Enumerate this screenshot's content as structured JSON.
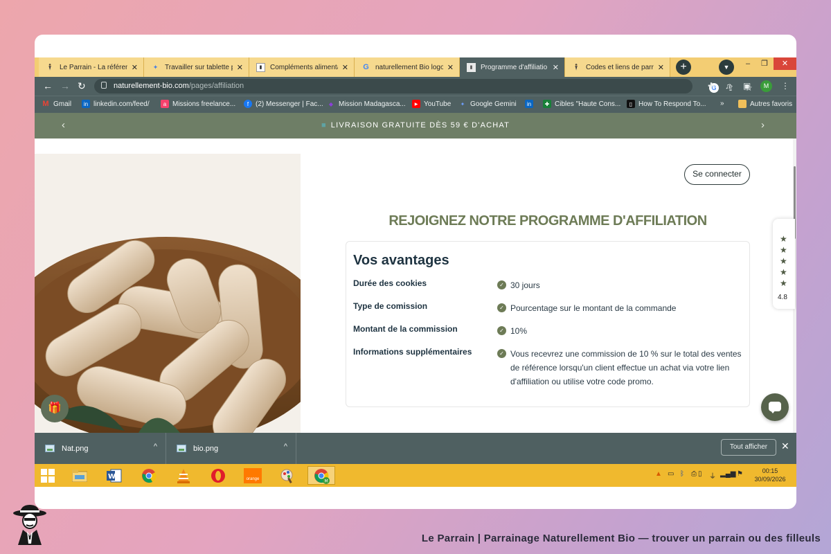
{
  "browser": {
    "tabs": [
      {
        "title": "Le Parrain - La référence",
        "favicon": "parrain-icon",
        "active": false
      },
      {
        "title": "Travailler sur tablette pr",
        "favicon": "gemini-icon",
        "active": false
      },
      {
        "title": "Compléments alimenta",
        "favicon": "page-icon",
        "active": false
      },
      {
        "title": "naturellement Bio logo",
        "favicon": "google-icon",
        "active": false
      },
      {
        "title": "Programme d'affiliatio",
        "favicon": "page-icon",
        "active": true
      },
      {
        "title": "Codes et liens de parrai",
        "favicon": "parrain-icon",
        "active": false
      }
    ],
    "new_tab_label": "+",
    "url_domain": "naturellement-bio.com",
    "url_path": "/pages/affiliation",
    "profile_initial": "M",
    "bookmarks": [
      "Gmail",
      "linkedin.com/feed/",
      "Missions freelance...",
      "(2) Messenger | Fac...",
      "Mission Madagasca...",
      "YouTube",
      "Google Gemini",
      "",
      "Cibles \"Haute Cons...",
      "How To Respond To..."
    ],
    "bookmarks_overflow": "»",
    "other_bookmarks": "Autres favoris"
  },
  "site": {
    "announcement": "LIVRAISON GRATUITE DÈS 59 € D'ACHAT",
    "login_button": "Se connecter",
    "page_title": "REJOIGNEZ NOTRE PROGRAMME D'AFFILIATION",
    "panel_title": "Vos avantages",
    "rows": [
      {
        "label": "Durée des cookies",
        "value": "30 jours"
      },
      {
        "label": "Type de comission",
        "value": "Pourcentage sur le montant de la commande"
      },
      {
        "label": "Montant de la commission",
        "value": "10%"
      },
      {
        "label": "Informations supplémentaires",
        "value": "Vous recevrez une commission de 10 % sur le total des ventes de référence lorsqu'un client effectue un achat via votre lien d'affiliation ou utilise votre code promo."
      }
    ],
    "rating": "4.8",
    "stars": 5
  },
  "downloads": {
    "files": [
      "Nat.png",
      "bio.png"
    ],
    "show_all": "Tout afficher"
  },
  "taskbar": {
    "time": "00:15",
    "date": "30/09/2026",
    "orange_label": "orange"
  },
  "footer": {
    "caption": "Le Parrain | Parrainage Naturellement Bio — trouver un parrain ou des filleuls"
  },
  "colors": {
    "accent_green": "#6d7b56",
    "browser_chrome": "#4f6061",
    "tab_strip": "#f3cd73",
    "taskbar": "#f0b92e",
    "navy_text": "#1e3341"
  }
}
